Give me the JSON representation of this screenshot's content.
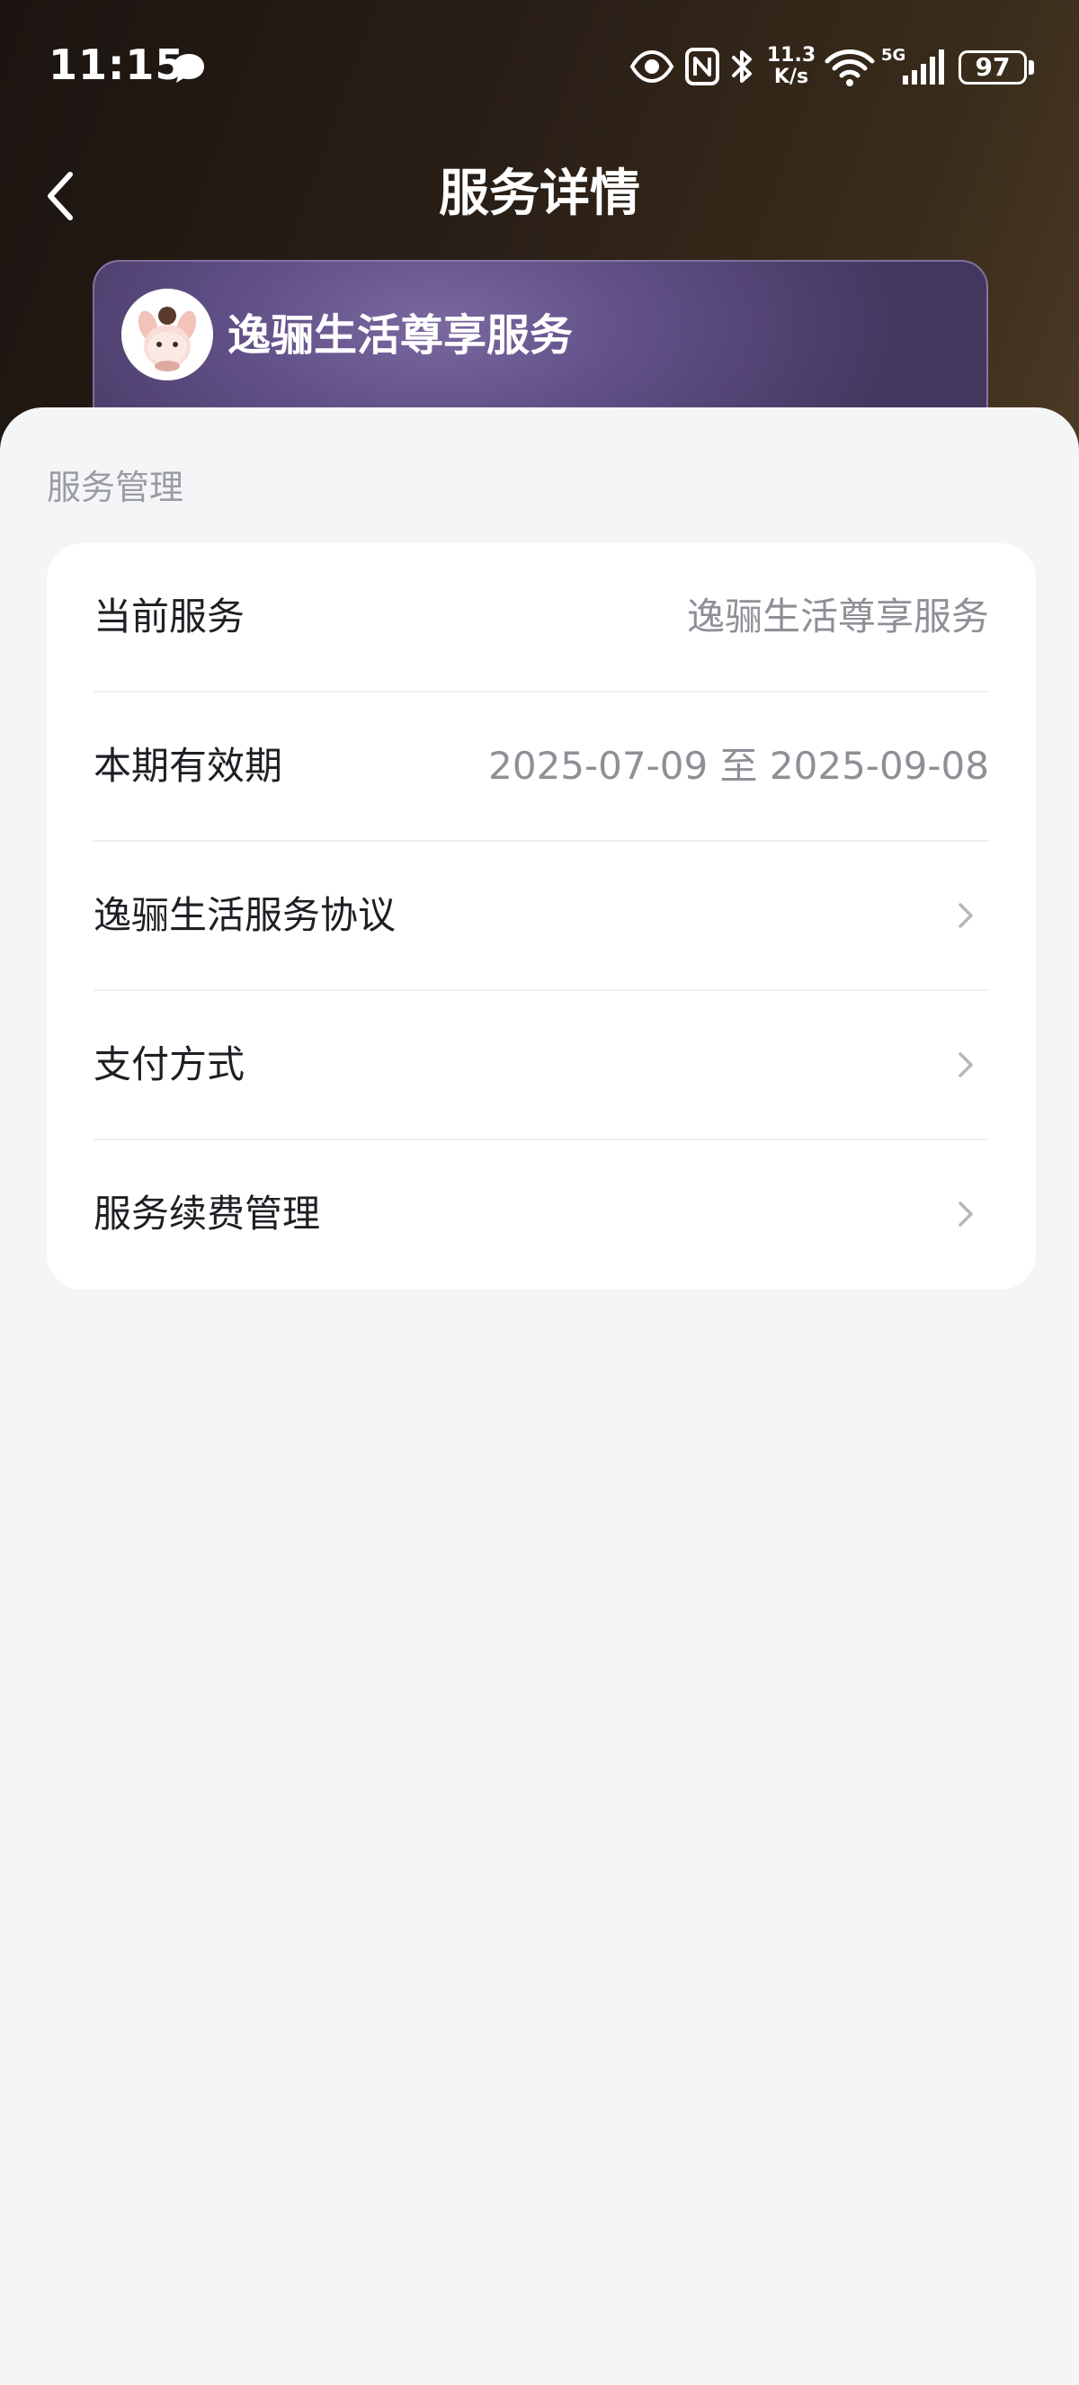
{
  "status_bar": {
    "time": "11:15",
    "net_speed_value": "11.3",
    "net_speed_unit": "K/s",
    "network_type": "5G",
    "battery_level": "97",
    "icons": [
      "message-icon",
      "eye-comfort-icon",
      "nfc-icon",
      "bluetooth-icon",
      "wifi-icon",
      "signal-icon",
      "battery-icon"
    ]
  },
  "header": {
    "title": "服务详情",
    "back_icon": "chevron-left-icon"
  },
  "service_card": {
    "name": "逸骊生活尊享服务",
    "avatar_icon": "mascot-avatar",
    "colors": {
      "card_start": "#7a689f",
      "card_end": "#44375f"
    }
  },
  "service_management": {
    "section_title": "服务管理",
    "rows": [
      {
        "label": "当前服务",
        "value": "逸骊生活尊享服务"
      },
      {
        "label": "本期有效期",
        "value": "2025-07-09 至 2025-09-08"
      },
      {
        "label": "逸骊生活服务协议",
        "icon": "chevron-right-icon"
      },
      {
        "label": "支付方式",
        "icon": "chevron-right-icon"
      },
      {
        "label": "服务续费管理",
        "icon": "chevron-right-icon"
      }
    ]
  },
  "colors": {
    "header_bg": "#2a1f17",
    "page_bg": "#f4f5f7",
    "card_bg": "#ffffff",
    "primary_text": "#1e1f24",
    "secondary_text": "#8e9097"
  }
}
